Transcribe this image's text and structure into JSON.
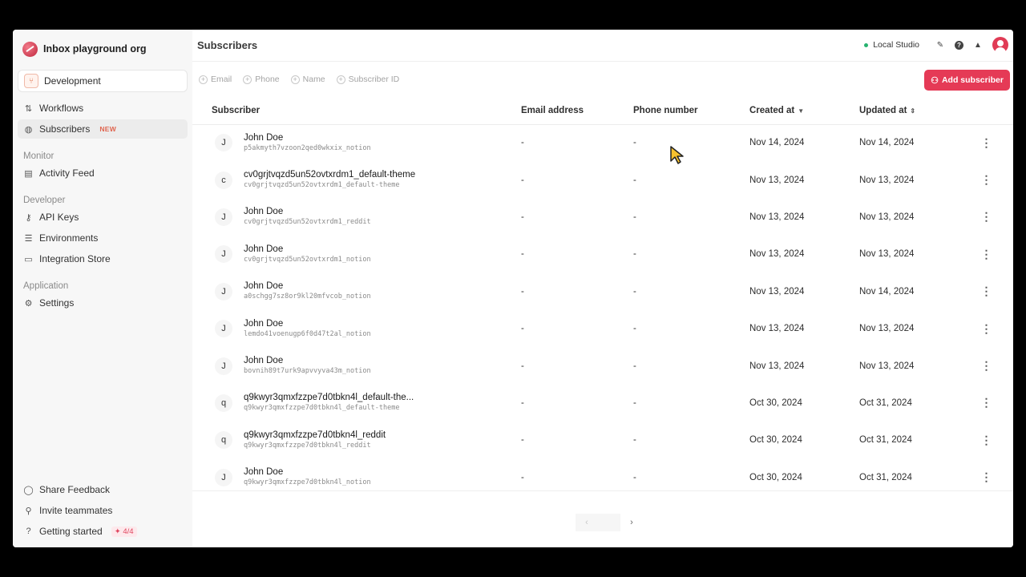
{
  "sidebar": {
    "org_name": "Inbox playground org",
    "environment": "Development",
    "nav": [
      {
        "label": "Workflows",
        "icon": "route-icon"
      },
      {
        "label": "Subscribers",
        "icon": "users-icon",
        "badge": "NEW"
      }
    ],
    "monitor": {
      "heading": "Monitor",
      "items": [
        {
          "label": "Activity Feed"
        }
      ]
    },
    "developer": {
      "heading": "Developer",
      "items": [
        {
          "label": "API Keys"
        },
        {
          "label": "Environments"
        },
        {
          "label": "Integration Store"
        }
      ]
    },
    "application": {
      "heading": "Application",
      "items": [
        {
          "label": "Settings"
        }
      ]
    },
    "bottom": [
      {
        "label": "Share Feedback"
      },
      {
        "label": "Invite teammates"
      },
      {
        "label": "Getting started",
        "badge": "4/4"
      }
    ]
  },
  "header": {
    "title": "Subscribers",
    "studio": "Local Studio"
  },
  "filters": [
    "Email",
    "Phone",
    "Name",
    "Subscriber ID"
  ],
  "add_button": "Add subscriber",
  "table": {
    "columns": [
      "Subscriber",
      "Email address",
      "Phone number",
      "Created at",
      "Updated at"
    ],
    "rows": [
      {
        "initial": "J",
        "name": "John Doe",
        "id": "p5akmyth7vzoon2qed0wkxix_notion",
        "email": "-",
        "phone": "-",
        "created": "Nov 14, 2024",
        "updated": "Nov 14, 2024"
      },
      {
        "initial": "c",
        "name": "cv0grjtvqzd5un52ovtxrdm1_default-theme",
        "id": "cv0grjtvqzd5un52ovtxrdm1_default-theme",
        "email": "-",
        "phone": "-",
        "created": "Nov 13, 2024",
        "updated": "Nov 13, 2024"
      },
      {
        "initial": "J",
        "name": "John Doe",
        "id": "cv0grjtvqzd5un52ovtxrdm1_reddit",
        "email": "-",
        "phone": "-",
        "created": "Nov 13, 2024",
        "updated": "Nov 13, 2024"
      },
      {
        "initial": "J",
        "name": "John Doe",
        "id": "cv0grjtvqzd5un52ovtxrdm1_notion",
        "email": "-",
        "phone": "-",
        "created": "Nov 13, 2024",
        "updated": "Nov 13, 2024"
      },
      {
        "initial": "J",
        "name": "John Doe",
        "id": "a0schgg7sz8or9kl20mfvcob_notion",
        "email": "-",
        "phone": "-",
        "created": "Nov 13, 2024",
        "updated": "Nov 14, 2024"
      },
      {
        "initial": "J",
        "name": "John Doe",
        "id": "lemdo41voenugp6f0d47t2al_notion",
        "email": "-",
        "phone": "-",
        "created": "Nov 13, 2024",
        "updated": "Nov 13, 2024"
      },
      {
        "initial": "J",
        "name": "John Doe",
        "id": "bovnih89t7urk9apvvyva43m_notion",
        "email": "-",
        "phone": "-",
        "created": "Nov 13, 2024",
        "updated": "Nov 13, 2024"
      },
      {
        "initial": "q",
        "name": "q9kwyr3qmxfzzpe7d0tbkn4l_default-the...",
        "id": "q9kwyr3qmxfzzpe7d0tbkn4l_default-theme",
        "email": "-",
        "phone": "-",
        "created": "Oct 30, 2024",
        "updated": "Oct 31, 2024"
      },
      {
        "initial": "q",
        "name": "q9kwyr3qmxfzzpe7d0tbkn4l_reddit",
        "id": "q9kwyr3qmxfzzpe7d0tbkn4l_reddit",
        "email": "-",
        "phone": "-",
        "created": "Oct 30, 2024",
        "updated": "Oct 31, 2024"
      },
      {
        "initial": "J",
        "name": "John Doe",
        "id": "q9kwyr3qmxfzzpe7d0tbkn4l_notion",
        "email": "-",
        "phone": "-",
        "created": "Oct 30, 2024",
        "updated": "Oct 31, 2024"
      }
    ]
  },
  "colors": {
    "accent": "#e53a56",
    "status_online": "#26b26f",
    "badge_new": "#e0654f"
  }
}
